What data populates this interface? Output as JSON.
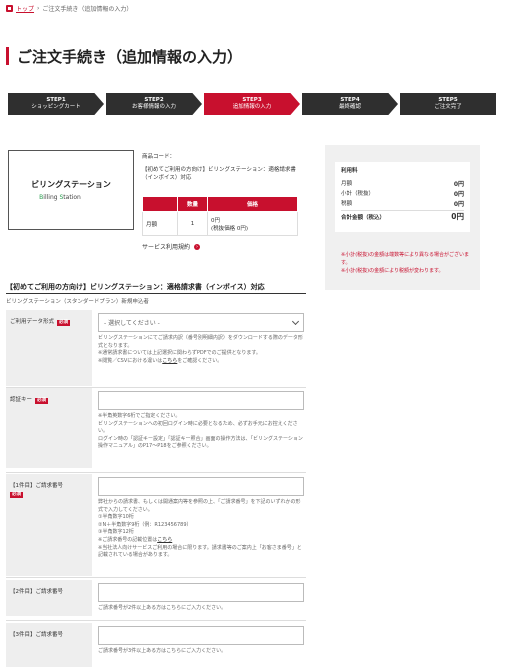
{
  "breadcrumb": {
    "home": "トップ",
    "sep": "›",
    "current": "ご注文手続き（追加情報の入力）"
  },
  "title": "ご注文手続き（追加情報の入力）",
  "steps": [
    {
      "num": "STEP1",
      "label": "ショッピングカート"
    },
    {
      "num": "STEP2",
      "label": "お客様情報の入力"
    },
    {
      "num": "STEP3",
      "label": "追加情報の入力"
    },
    {
      "num": "STEP4",
      "label": "最終確認"
    },
    {
      "num": "STEP5",
      "label": "ご注文完了"
    }
  ],
  "active_step": 2,
  "product": {
    "logo_title": "ビリングステーション",
    "logo_sub_1": "B",
    "logo_sub_2": "illing ",
    "logo_sub_3": "S",
    "logo_sub_4": "tation",
    "code_label": "商品コード：",
    "name": "【初めてご利用の方向け】ビリングステーション：適格請求書（インボイス）対応",
    "table": {
      "headers": [
        "",
        "数量",
        "価格"
      ],
      "row": {
        "term": "月額",
        "qty": "1",
        "price": "0円",
        "price_sub": "(税抜価格 0円)"
      }
    },
    "terms_link": "サービス利用規約"
  },
  "summary": {
    "title": "利用料",
    "rows": [
      {
        "label": "月額",
        "value": "0円"
      },
      {
        "label": "小計（税抜）",
        "value": "0円"
      },
      {
        "label": "税額",
        "value": "0円"
      }
    ],
    "total_label": "合計金額（税込）",
    "total_value": "0円",
    "note1": "※小計(税抜)の金額は端数等により異なる場合がございます。",
    "note2": "※小計(税抜)の金額により税額が変わります。"
  },
  "section": {
    "title": "【初めてご利用の方向け】ビリングステーション：適格請求書（インボイス）対応",
    "plan": "ビリングステーション（スタンダードプラン）新規申込者"
  },
  "form": {
    "required": "必須",
    "data_format": {
      "label": "ご利用データ形式",
      "placeholder": "- 選択してください -",
      "help1": "ビリングステーションにてご請求内訳（番号別明細内訳）をダウンロードする際のデータ形式となります。",
      "help2": "※通常請求書については上記選択に関わらずPDFでのご提供となります。",
      "help3a": "※閲覧／CSVにおける違いは",
      "help3b": "こちら",
      "help3c": "をご確認ください。"
    },
    "auth_key": {
      "label": "認証キー",
      "help1": "※半角英数字6桁でご指定ください。",
      "help2": "ビリングステーションへの初回ログイン時に必要となるため、必ずお手元にお控えください。",
      "help3": "ログイン時の「認証キー設定」「認証キー照合」画面の操作方法は、「ビリングステーション操作マニュアル」のP17〜P18をご参照ください。"
    },
    "invoice1": {
      "label": "【1件目】ご請求番号",
      "help1": "弊社からの請求書、もしくは開通案内等を参照の上、「ご請求番号」を下記のいずれかの形式で入力してください。",
      "help2": "①半角数字10桁",
      "help3": "②N＋半角数字9桁（例：R123456789）",
      "help4": "③半角数字12桁",
      "help5a": "※ご請求番号の記載位置は",
      "help5b": "こちら",
      "help6": "※当社法人向けサービスご利用の場合に限ります。請求書等のご案内上「お客さま番号」と記載されている場合があります。"
    },
    "invoice2": {
      "label": "【2件目】ご請求番号",
      "help": "ご請求番号が2件以上ある方はこちらにご入力ください。"
    },
    "invoice3": {
      "label": "【3件目】ご請求番号",
      "help": "ご請求番号が3件以上ある方はこちらにご入力ください。"
    }
  },
  "colors": {
    "accent": "#c8102e",
    "step_dark": "#2f2f2f",
    "label_bg": "#eeeeee"
  }
}
